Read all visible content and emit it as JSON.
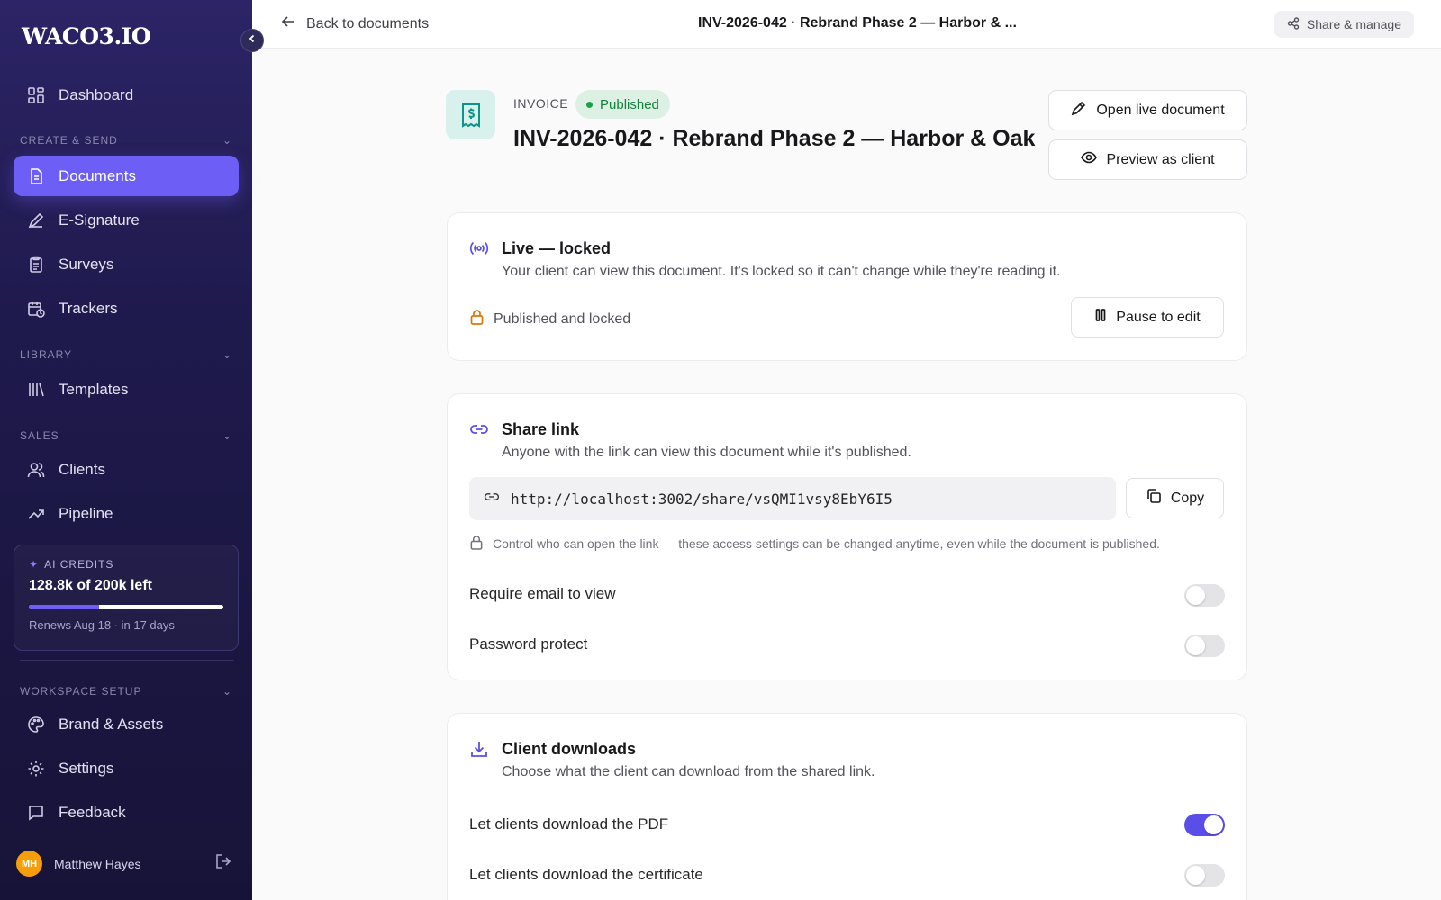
{
  "sidebar": {
    "logo": "WACO3.IO",
    "dashboard": "Dashboard",
    "sections": {
      "create_send": "CREATE & SEND",
      "library": "LIBRARY",
      "sales": "SALES",
      "workspace_setup": "WORKSPACE SETUP"
    },
    "items": {
      "documents": "Documents",
      "esignature": "E-Signature",
      "surveys": "Surveys",
      "trackers": "Trackers",
      "templates": "Templates",
      "clients": "Clients",
      "pipeline": "Pipeline",
      "brand_assets": "Brand & Assets",
      "settings": "Settings",
      "feedback": "Feedback"
    },
    "credits": {
      "label": "AI CREDITS",
      "amount": "128.8k of 200k left",
      "used_fraction": 0.36,
      "renews": "Renews Aug 18 · in 17 days"
    },
    "user": {
      "initials": "MH",
      "name": "Matthew Hayes"
    }
  },
  "topbar": {
    "back": "Back to documents",
    "title": "INV-2026-042 · Rebrand Phase 2 — Harbor & ...",
    "share_manage": "Share & manage"
  },
  "header": {
    "doc_type": "INVOICE",
    "status": "Published",
    "title": "INV-2026-042 · Rebrand Phase 2 — Harbor & Oak",
    "open_live": "Open live document",
    "preview": "Preview as client"
  },
  "live_card": {
    "title": "Live — locked",
    "subtitle": "Your client can view this document. It's locked so it can't change while they're reading it.",
    "status": "Published and locked",
    "pause_btn": "Pause to edit"
  },
  "share_card": {
    "title": "Share link",
    "subtitle": "Anyone with the link can view this document while it's published.",
    "url": "http://localhost:3002/share/vsQMI1vsy8EbY6I5",
    "copy_btn": "Copy",
    "note": "Control who can open the link — these access settings can be changed anytime, even while the document is published.",
    "require_email": "Require email to view",
    "require_email_on": false,
    "password": "Password protect",
    "password_on": false
  },
  "downloads_card": {
    "title": "Client downloads",
    "subtitle": "Choose what the client can download from the shared link.",
    "pdf": "Let clients download the PDF",
    "pdf_on": true,
    "certificate": "Let clients download the certificate",
    "certificate_on": false
  },
  "colors": {
    "accent": "#6d5ff5",
    "sidebar_bg": "#1f1a4d",
    "published_green": "#16a34a",
    "lock_orange": "#d97706"
  }
}
